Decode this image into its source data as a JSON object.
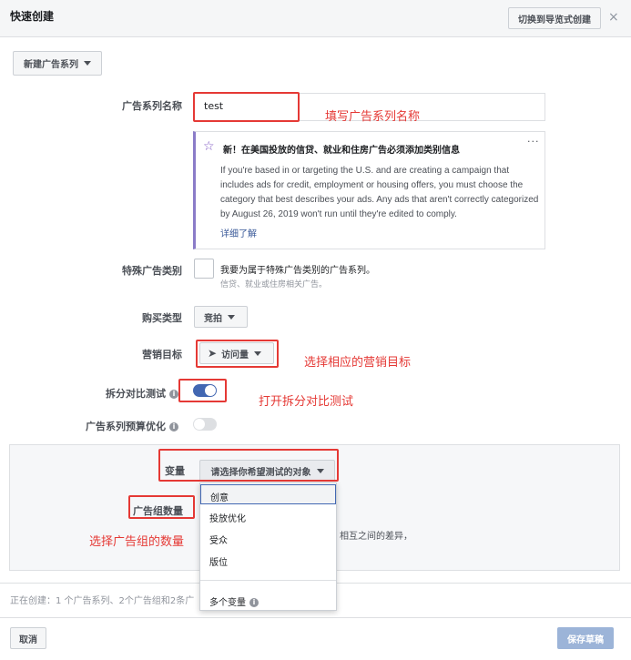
{
  "header": {
    "title": "快速创建",
    "switch_label": "切换到导览式创建",
    "close_label": "×"
  },
  "toolbar": {
    "new_campaign_label": "新建广告系列"
  },
  "campaign_name": {
    "label": "广告系列名称",
    "value": "test",
    "note": "填写广告系列名称"
  },
  "notice": {
    "title": "新！在美国投放的信贷、就业和住房广告必须添加类别信息",
    "body": "If you're based in or targeting the U.S. and are creating a campaign that includes ads for credit, employment or housing offers, you must choose the category that best describes your ads. Any ads that aren't correctly categorized by August 26, 2019 won't run until they're edited to comply.",
    "link": "详细了解",
    "more": "···"
  },
  "special_category": {
    "label": "特殊广告类别",
    "checkbox_text": "我要为属于特殊广告类别的广告系列。",
    "sub_text": "信贷、就业或住房相关广告。"
  },
  "buying_type": {
    "label": "购买类型",
    "value": "竞拍"
  },
  "objective": {
    "label": "营销目标",
    "value": "访问量",
    "note": "选择相应的营销目标"
  },
  "split_test": {
    "label": "拆分对比测试",
    "on": true,
    "note": "打开拆分对比测试"
  },
  "cbo": {
    "label": "广告系列预算优化",
    "on": false
  },
  "variable": {
    "label": "变量",
    "placeholder": "请选择你希望测试的对象"
  },
  "adset_count": {
    "label": "广告组数量",
    "note": "选择广告组的数量",
    "partial_text": "相互之间的差异，"
  },
  "menu": {
    "items": [
      "创意",
      "投放优化",
      "受众",
      "版位"
    ],
    "multi": "多个变量"
  },
  "footer": {
    "status": "正在创建：1 个广告系列、2个广告组和2条广",
    "cancel": "取消",
    "save": "保存草稿"
  },
  "colors": {
    "accent": "#4267b2",
    "annotation": "#e53935",
    "save_disabled": "#9cb4d8"
  }
}
